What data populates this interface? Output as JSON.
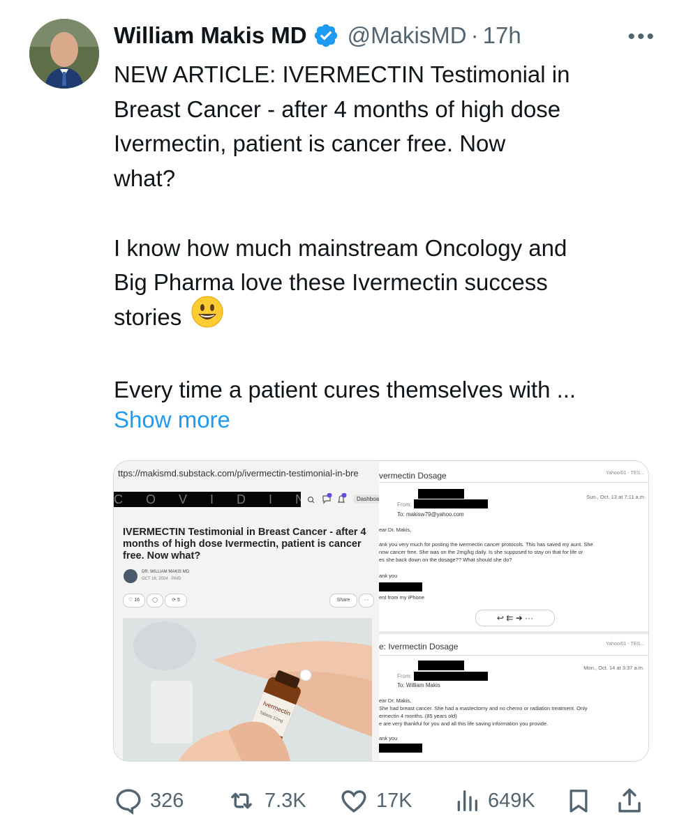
{
  "author": {
    "name": "William Makis MD",
    "handle": "@MakisMD",
    "separator": "·",
    "time": "17h"
  },
  "more_label": "•••",
  "tweet": {
    "line1": "NEW ARTICLE: IVERMECTIN Testimonial in",
    "line2": "Breast Cancer - after 4 months of high dose",
    "line3": "Ivermectin, patient is cancer free. Now",
    "line4": "what?",
    "line5": "I know how much mainstream Oncology and",
    "line6": "Big Pharma love these Ivermectin success",
    "line7": "stories",
    "line8": "Every time a patient cures themselves with ...",
    "show_more": "Show more"
  },
  "image_left": {
    "url": "ttps://makismd.substack.com/p/ivermectin-testimonial-in-bre",
    "banner": "C O V I D   I N T",
    "dashboard": "Dashboard",
    "title": "IVERMECTIN Testimonial in Breast Cancer - after 4 months of high dose Ivermectin, patient is cancer free. Now what?",
    "author": "DR. WILLIAM MAKIS MD",
    "date": "OCT 16, 2024 · PAID",
    "likes": "16",
    "restacks": "5",
    "share": "Share",
    "dots": "···"
  },
  "image_right": {
    "email1": {
      "subject": "vermectin Dosage",
      "tag": "Yahoo/01 - TES...",
      "date": "Sun., Oct. 13 at 7:11 a.m",
      "from": "From:",
      "to": "To: makisw79@yahoo.com",
      "greeting": "ear Dr. Makis,",
      "body1": "ank you very much for posting the ivermectin cancer protocols.  This has saved my aunt.  She",
      "body2": "now cancer free.   She was on the 2mg/kg daily.  Is she supposed to stay on that for life or",
      "body3": "es she back down on the dosage?? What should she do?",
      "thanks": "ank you",
      "sent": "ent from my iPhone"
    },
    "email2": {
      "subject": "e: Ivermectin Dosage",
      "tag": "Yahoo/01 - TES...",
      "date": "Mon., Oct. 14 at 3:37 a.m.",
      "from": "From:",
      "to": "To: William Makis",
      "greeting": "ear Dr. Makis,",
      "body1": "  She had breast cancer.  She had a mastectomy  and no chemo or radiation treatment.  Only",
      "body2": "ermectin 4 months. (85 years old)",
      "body3": "e are very thankful for you and all this life saving information you provide.",
      "thanks": "ank you"
    }
  },
  "actions": {
    "replies": "326",
    "reposts": "7.3K",
    "likes": "17K",
    "views": "649K"
  },
  "colors": {
    "link": "#1d9bf0",
    "verified": "#1d9bf0",
    "muted": "#536471"
  }
}
